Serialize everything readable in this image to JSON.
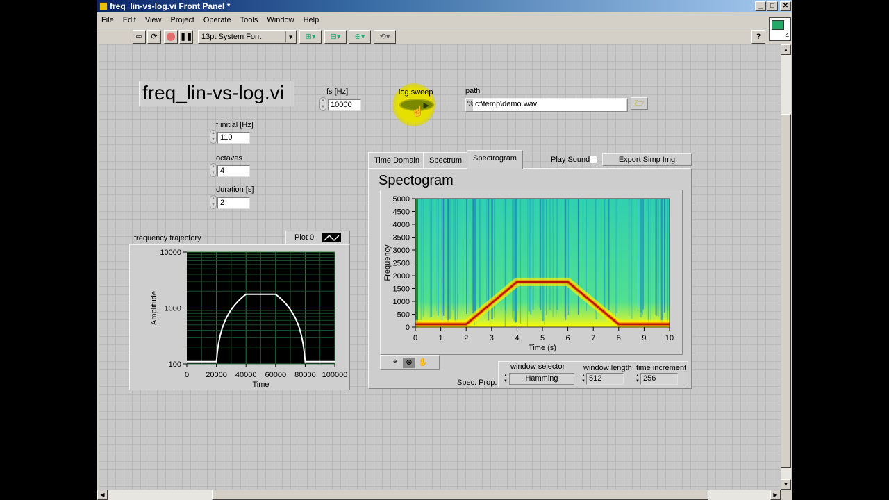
{
  "window": {
    "title": "freq_lin-vs-log.vi Front Panel *",
    "controls": [
      "_",
      "□",
      "✕"
    ]
  },
  "menu": [
    "File",
    "Edit",
    "View",
    "Project",
    "Operate",
    "Tools",
    "Window",
    "Help"
  ],
  "toolbar": {
    "font_selector": "13pt System Font",
    "help": "?",
    "connector_pane_number": "4"
  },
  "panel": {
    "vi_label": "freq_lin-vs-log.vi",
    "fs": {
      "label": "fs [Hz]",
      "value": "10000"
    },
    "log_sweep": {
      "label": "log sweep",
      "state": true
    },
    "path": {
      "label": "path",
      "value": "c:\\temp\\demo.wav"
    },
    "f_initial": {
      "label": "f initial [Hz]",
      "value": "110"
    },
    "octaves": {
      "label": "octaves",
      "value": "4"
    },
    "duration": {
      "label": "duration [s]",
      "value": "2"
    },
    "trajectory": {
      "label": "frequency trajectory",
      "legend": "Plot 0"
    },
    "tabs": [
      {
        "label": "Time Domain",
        "active": false
      },
      {
        "label": "Spectrum",
        "active": false
      },
      {
        "label": "Spectrogram",
        "active": true
      }
    ],
    "play_sound": {
      "label": "Play Sound",
      "checked": false
    },
    "export_button": "Export Simp Img",
    "spectrogram_title": "Spectogram",
    "spec_prop": {
      "label": "Spec. Prop.",
      "window_selector_label": "window selector",
      "window_selector": "Hamming",
      "window_length_label": "window length",
      "window_length": "512",
      "time_increment_label": "time increment",
      "time_increment": "256"
    }
  },
  "chart_data": [
    {
      "type": "line",
      "xlabel": "Time",
      "ylabel": "Amplitude",
      "xlim": [
        0,
        100000
      ],
      "ylim": [
        100,
        10000
      ],
      "yscale": "log",
      "xticks": [
        "0",
        "20000",
        "40000",
        "60000",
        "80000",
        "100000"
      ],
      "yticks": [
        "100",
        "1000",
        "10000"
      ],
      "grid": true,
      "line_color": "#ffffff",
      "background": "#000000",
      "series": [
        {
          "name": "Plot 0",
          "x": [
            0,
            20000,
            40000,
            60000,
            80000,
            100000
          ],
          "y": [
            110,
            110,
            1760,
            1760,
            110,
            110
          ],
          "interpolation": "linear-in-frequency"
        }
      ]
    },
    {
      "type": "heatmap",
      "xlabel": "Time (s)",
      "ylabel": "Frequency",
      "xlim": [
        0,
        10
      ],
      "ylim": [
        0,
        5000
      ],
      "xticks": [
        "0",
        "1",
        "2",
        "3",
        "4",
        "5",
        "6",
        "7",
        "8",
        "9",
        "10"
      ],
      "yticks": [
        "0",
        "500",
        "1000",
        "1500",
        "2000",
        "2500",
        "3000",
        "3500",
        "4000",
        "4500",
        "5000"
      ],
      "ridge": {
        "x": [
          0,
          2,
          4,
          6,
          8,
          10
        ],
        "y": [
          110,
          110,
          1760,
          1760,
          110,
          110
        ],
        "color": "#b01a00"
      },
      "colormap": [
        "#1a5fb4",
        "#20c0c0",
        "#40e0a0",
        "#ffff00",
        "#ff8000",
        "#b01a00"
      ]
    }
  ]
}
